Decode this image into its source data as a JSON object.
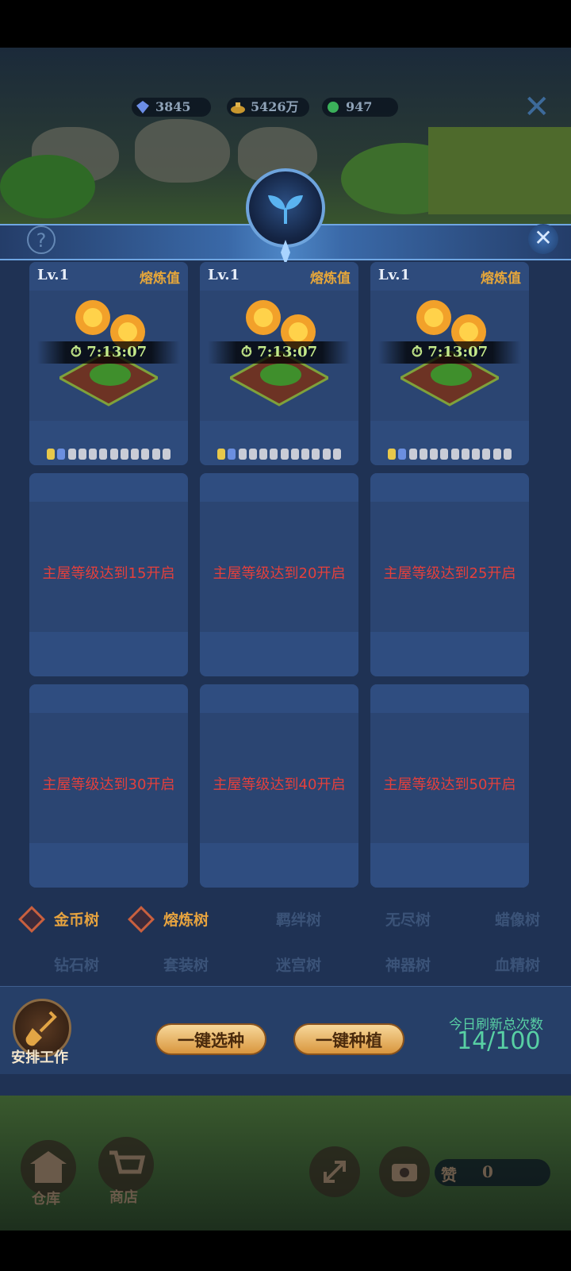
{
  "currencies": [
    {
      "name": "diamond",
      "value": "3845",
      "icon": "diamond-icon",
      "color": "#6c8ee6"
    },
    {
      "name": "gold",
      "value": "5426万",
      "icon": "gold-pile-icon",
      "color": "#c8962e"
    },
    {
      "name": "jade",
      "value": "947",
      "icon": "green-gem-icon",
      "color": "#3bb05a"
    }
  ],
  "header": {
    "help_symbol": "?",
    "close_symbol": "✕",
    "outer_close_symbol": "✕",
    "emblem_icon": "sprout-icon"
  },
  "plots": [
    {
      "level": "Lv.1",
      "value_label": "熔炼值",
      "timer": "7:13:07"
    },
    {
      "level": "Lv.1",
      "value_label": "熔炼值",
      "timer": "7:13:07"
    },
    {
      "level": "Lv.1",
      "value_label": "熔炼值",
      "timer": "7:13:07"
    }
  ],
  "locked": [
    {
      "message": "主屋等级达到15开启"
    },
    {
      "message": "主屋等级达到20开启"
    },
    {
      "message": "主屋等级达到25开启"
    },
    {
      "message": "主屋等级达到30开启"
    },
    {
      "message": "主屋等级达到40开启"
    },
    {
      "message": "主屋等级达到50开启"
    }
  ],
  "trees_row1": [
    {
      "label": "金币树",
      "selected": true
    },
    {
      "label": "熔炼树",
      "selected": true
    },
    {
      "label": "羁绊树",
      "selected": false
    },
    {
      "label": "无尽树",
      "selected": false
    },
    {
      "label": "蜡像树",
      "selected": false
    }
  ],
  "trees_row2": [
    {
      "label": "钻石树"
    },
    {
      "label": "套装树"
    },
    {
      "label": "迷宫树"
    },
    {
      "label": "神器树"
    },
    {
      "label": "血精树"
    }
  ],
  "actions": {
    "arrange_label": "安排工作",
    "select_seed_label": "一键选种",
    "plant_label": "一键种植",
    "refresh_title": "今日刷新总次数",
    "refresh_count": "14/100"
  },
  "hud": {
    "warehouse_label": "仓库",
    "shop_label": "商店",
    "like_label": "赞",
    "like_count": "0"
  }
}
